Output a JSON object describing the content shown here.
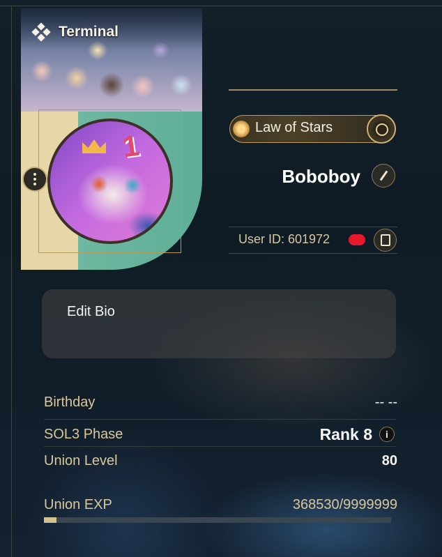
{
  "card": {
    "title": "Terminal",
    "title_icon": "diamond-cluster-icon"
  },
  "profile": {
    "badge_label": "Law of Stars",
    "username": "Boboboy",
    "user_id": "User ID: 601972",
    "user_id_redacted": true
  },
  "bio": {
    "label": "Edit Bio"
  },
  "stats": {
    "birthday_label": "Birthday",
    "birthday_value": "-- --",
    "phase_label": "SOL3 Phase",
    "phase_value": "Rank 8",
    "union_level_label": "Union Level",
    "union_level_value": "80",
    "union_exp_label": "Union EXP",
    "union_exp_value": "368530/9999999",
    "union_exp_fraction": 0.037
  },
  "colors": {
    "accent_gold": "#d9c89a",
    "badge_border": "#b99c5e",
    "redaction": "#e8172a"
  },
  "icons": {
    "menu": "more-vertical-icon",
    "edit": "pencil-icon",
    "copy": "copy-icon",
    "info": "info-icon"
  }
}
